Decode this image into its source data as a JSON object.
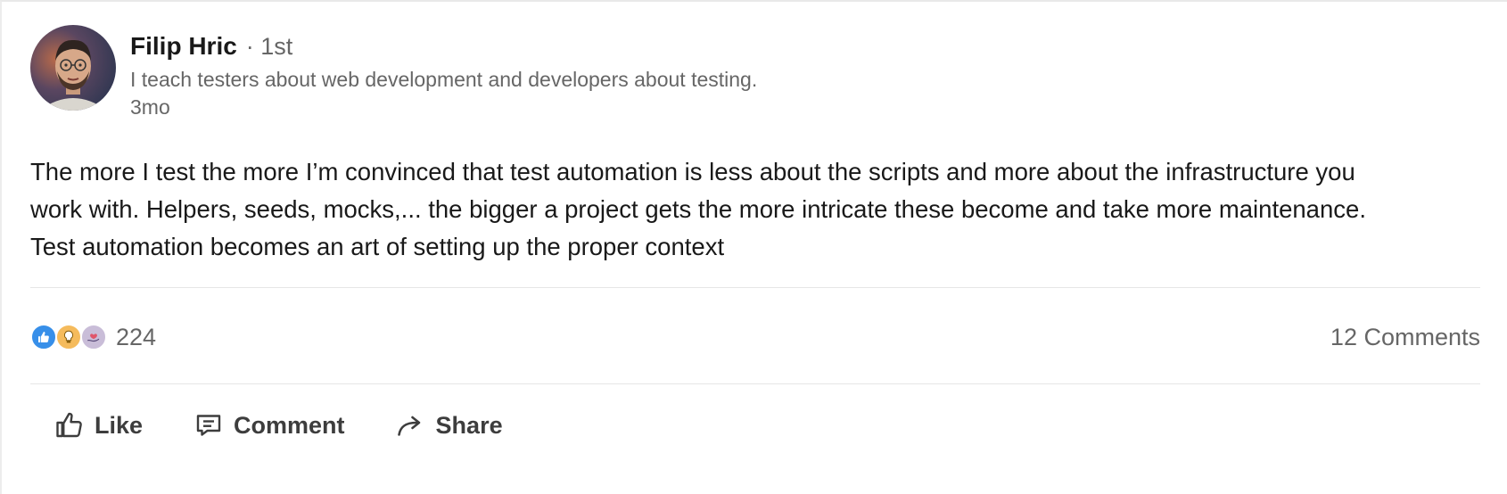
{
  "post": {
    "author": {
      "name": "Filip Hric",
      "degree": "· 1st",
      "headline": "I teach testers about web development and developers about testing.",
      "time": "3mo"
    },
    "body_lines": [
      "The more I test the more I’m convinced that test automation is less about the scripts and more about the infrastructure you",
      "work with. Helpers, seeds, mocks,... the bigger a project gets the more intricate these become and take more maintenance.",
      "Test automation becomes an art of setting up the proper context"
    ],
    "social": {
      "reaction_icons": [
        "like-icon",
        "insightful-icon",
        "support-icon"
      ],
      "reaction_count": "224",
      "comments": "12 Comments"
    },
    "actions": {
      "like": "Like",
      "comment": "Comment",
      "share": "Share"
    },
    "colors": {
      "like_blue": "#378fe9",
      "insight_yellow": "#f5bb5c",
      "support_purple": "#c9bdd8",
      "secondary_text": "#666666",
      "primary_text": "#191919"
    }
  }
}
